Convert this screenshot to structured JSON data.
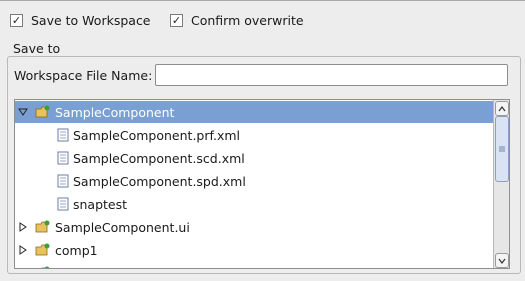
{
  "options": {
    "save_to_workspace": {
      "label": "Save to Workspace",
      "checked": true
    },
    "confirm_overwrite": {
      "label": "Confirm overwrite",
      "checked": true
    }
  },
  "save_to": {
    "group_label": "Save to",
    "workspace_file_name_label": "Workspace File Name:",
    "workspace_file_name_value": ""
  },
  "tree": {
    "items": [
      {
        "label": "SampleComponent",
        "type": "project",
        "expanded": true,
        "selected": true
      },
      {
        "label": "SampleComponent.prf.xml",
        "type": "file"
      },
      {
        "label": "SampleComponent.scd.xml",
        "type": "file"
      },
      {
        "label": "SampleComponent.spd.xml",
        "type": "file"
      },
      {
        "label": "snaptest",
        "type": "file"
      },
      {
        "label": "SampleComponent.ui",
        "type": "project",
        "expanded": false
      },
      {
        "label": "comp1",
        "type": "project",
        "expanded": false
      }
    ]
  },
  "colors": {
    "selection": "#7a9fd2",
    "folder": "#e8c25a",
    "project_badge": "#3aa03a"
  }
}
